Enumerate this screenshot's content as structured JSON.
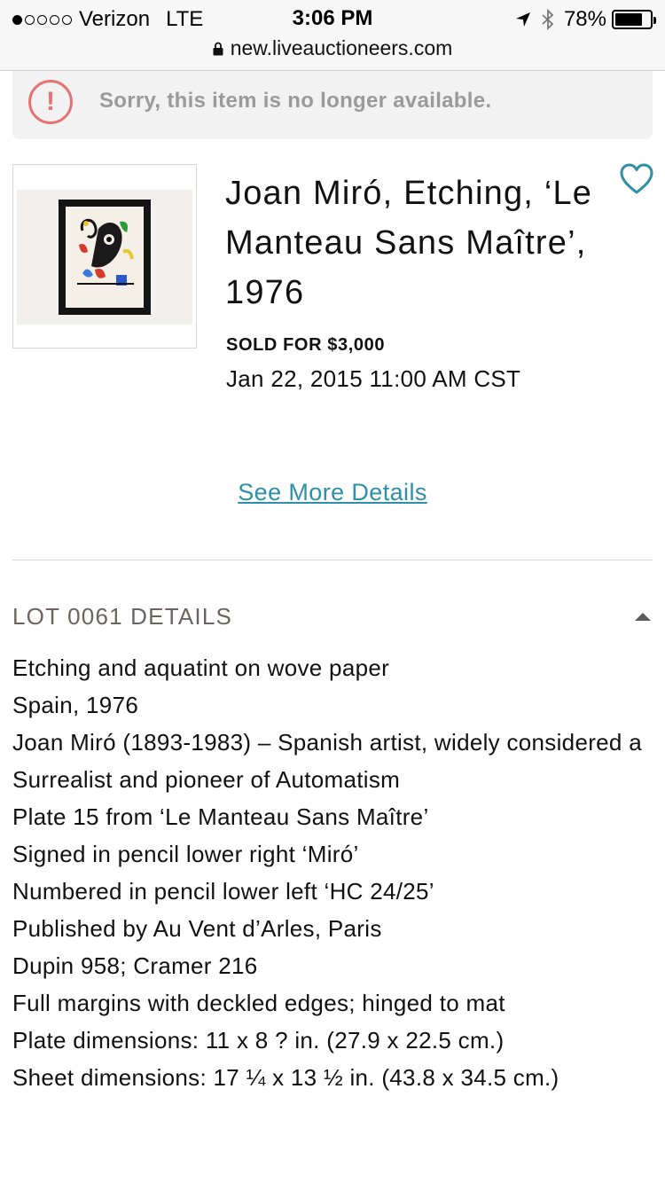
{
  "status_bar": {
    "carrier": "Verizon",
    "network": "LTE",
    "time": "3:06 PM",
    "battery": "78%",
    "battery_level": 0.78
  },
  "url_bar": {
    "url": "new.liveauctioneers.com"
  },
  "notice": {
    "icon": "alert-circle-icon",
    "text": "Sorry, this item is no longer available."
  },
  "item": {
    "title": "Joan Miró, Etching, ‘Le Manteau Sans Maître’, 1976",
    "sold_label": "SOLD FOR $3,000",
    "date": "Jan 22, 2015 11:00 AM CST",
    "favorite_icon": "heart-outline-icon",
    "see_more": "See More Details"
  },
  "lot": {
    "header": "LOT 0061 DETAILS",
    "toggle_icon": "caret-up-icon",
    "lines": [
      "Etching and aquatint on wove paper",
      "Spain, 1976",
      "Joan Miró (1893-1983) – Spanish artist, widely considered a Surrealist and pioneer of Automatism",
      "Plate 15 from ‘Le Manteau Sans Maître’",
      "Signed in pencil lower right ‘Miró’",
      "Numbered in pencil lower left ‘HC 24/25’",
      "Published by Au Vent d’Arles, Paris",
      "Dupin 958; Cramer 216",
      "Full margins with deckled edges; hinged to mat",
      "Plate dimensions: 11 x 8 ? in. (27.9 x 22.5 cm.)",
      "Sheet dimensions: 17 ¼ x 13 ½ in. (43.8 x 34.5 cm.)"
    ]
  },
  "colors": {
    "accent": "#2e8fa6",
    "alert": "#e57373",
    "muted": "#9a9a9a",
    "lot_header": "#6b6360"
  }
}
